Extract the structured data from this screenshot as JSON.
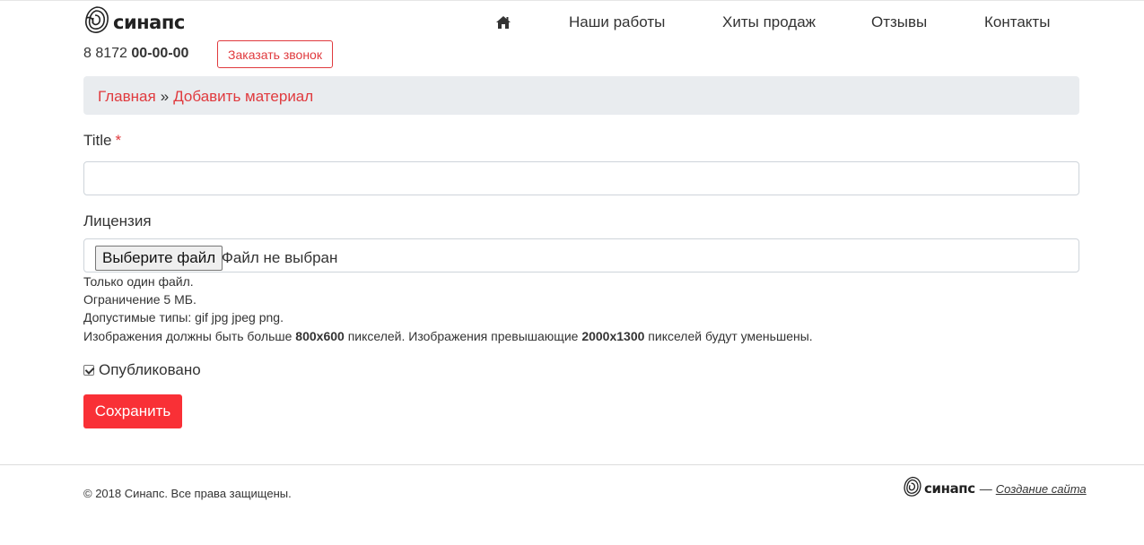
{
  "brand": {
    "name": "синапс"
  },
  "header": {
    "phone_code": "8 8172",
    "phone_number": "00-00-00",
    "callback_label": "Заказать звонок"
  },
  "nav": {
    "home_icon": "home-icon",
    "items": [
      {
        "label": "Наши работы"
      },
      {
        "label": "Хиты продаж"
      },
      {
        "label": "Отзывы"
      },
      {
        "label": "Контакты"
      }
    ]
  },
  "breadcrumb": {
    "home": "Главная",
    "separator": "»",
    "current": "Добавить материал"
  },
  "form": {
    "title_label": "Title",
    "required_mark": "*",
    "title_value": "",
    "license_label": "Лицензия",
    "file_button": "Выберите файл",
    "file_status": "Файл не выбран",
    "help": {
      "line1": "Только один файл.",
      "line2": "Ограничение 5 МБ.",
      "line3": "Допустимые типы: gif jpg jpeg png.",
      "line4_a": "Изображения должны быть больше ",
      "line4_min": "800x600",
      "line4_b": " пикселей. Изображения превышающие ",
      "line4_max": "2000x1300",
      "line4_c": " пикселей будут уменьшены."
    },
    "published_label": "Опубликовано",
    "published_checked": true,
    "save_label": "Сохранить"
  },
  "footer": {
    "copyright": "© 2018 Синапс. Все права защищены.",
    "brand_name": "синапс",
    "dash": "—",
    "credit": "Создание сайта"
  },
  "colors": {
    "accent": "#e03a3e",
    "save_button": "#f93036",
    "breadcrumb_bg": "#e9ecef"
  }
}
